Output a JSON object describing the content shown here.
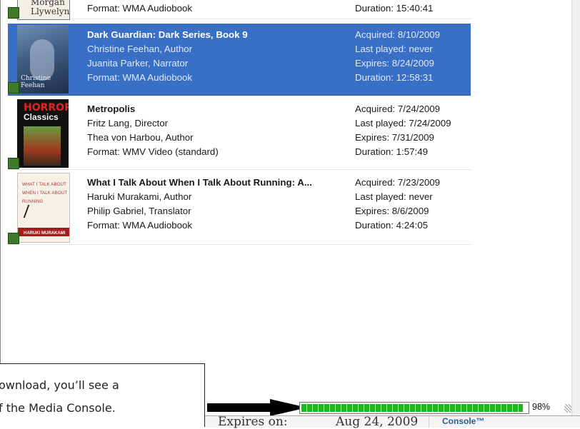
{
  "items": [
    {
      "title": "",
      "cover_text": "Morgan\nLlywelyn",
      "line1": "",
      "line2": "",
      "line3": "Format: WMA Audiobook",
      "info3": "Duration: 15:40:41"
    },
    {
      "title": "Dark Guardian: Dark Series, Book 9",
      "line1": "Christine Feehan, Author",
      "line2": "Juanita Parker, Narrator",
      "line3": "Format: WMA Audiobook",
      "info0": "Acquired: 8/10/2009",
      "info1": "Last played: never",
      "info2": "Expires: 8/24/2009",
      "info3": "Duration: 12:58:31",
      "selected": true
    },
    {
      "title": "Metropolis",
      "cover_text": "HORROR Classics",
      "line1": "Fritz Lang, Director",
      "line2": "Thea von Harbou, Author",
      "line3": "Format: WMV Video (standard)",
      "info0": "Acquired: 7/24/2009",
      "info1": "Last played: 7/24/2009",
      "info2": "Expires: 7/31/2009",
      "info3": "Duration: 1:57:49"
    },
    {
      "title": "What I Talk About When I Talk About Running: A...",
      "cover_text": "WHAT I TALK ABOUT WHEN I TALK ABOUT RUNNING HARUKI MURAKAMI",
      "line1": "Haruki Murakami, Author",
      "line2": "Philip Gabriel, Translator",
      "line3": "Format: WMA Audiobook",
      "info0": "Acquired: 7/23/2009",
      "info1": "Last played: never",
      "info2": "Expires: 8/6/2009",
      "info3": "Duration: 4:24:05"
    }
  ],
  "callout": {
    "line1": "ownload, you’ll see a",
    "line2": "f the Media Console."
  },
  "progress": {
    "value": 0.98,
    "label": "98%"
  },
  "status": {
    "left": "Expires on:",
    "mid": "Aug 24, 2009",
    "console": "Console™"
  }
}
